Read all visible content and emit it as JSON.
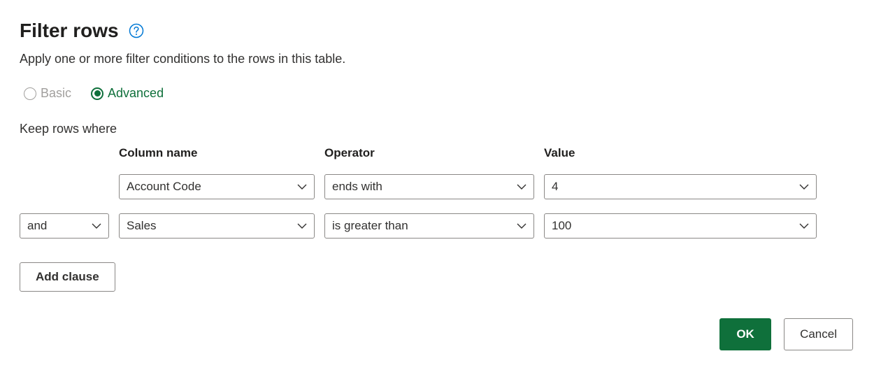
{
  "title": "Filter rows",
  "subtitle": "Apply one or more filter conditions to the rows in this table.",
  "mode": {
    "basic_label": "Basic",
    "advanced_label": "Advanced",
    "selected": "advanced"
  },
  "keep_label": "Keep rows where",
  "headers": {
    "column": "Column name",
    "operator": "Operator",
    "value": "Value"
  },
  "clauses": [
    {
      "logic": "",
      "column": "Account Code",
      "operator": "ends with",
      "value": "4"
    },
    {
      "logic": "and",
      "column": "Sales",
      "operator": "is greater than",
      "value": "100"
    }
  ],
  "add_clause_label": "Add clause",
  "buttons": {
    "ok": "OK",
    "cancel": "Cancel"
  }
}
